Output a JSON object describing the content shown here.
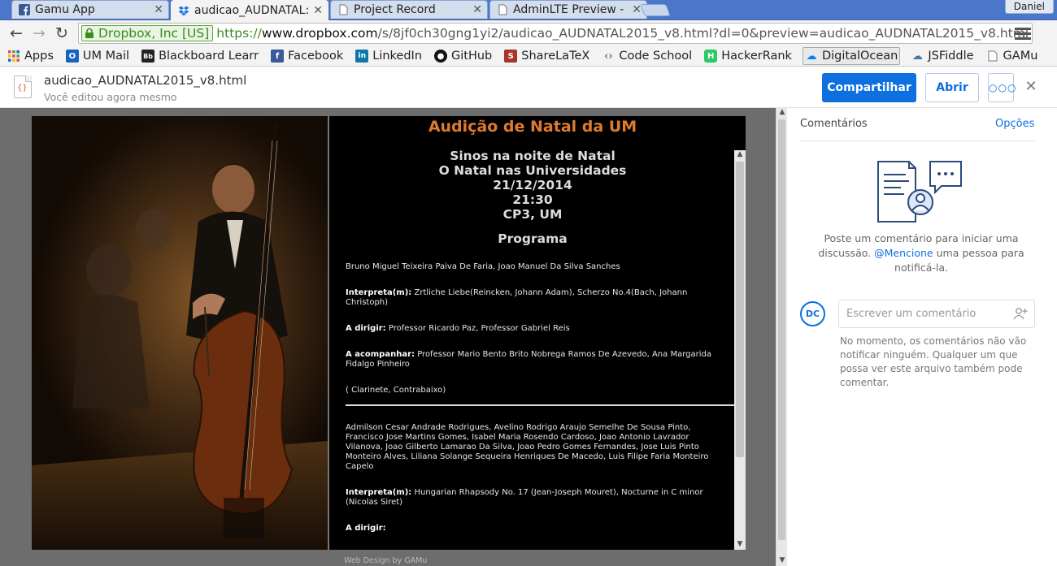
{
  "tabs": [
    {
      "title": "Gamu App",
      "icon": "facebook-icon"
    },
    {
      "title": "audicao_AUDNATAL:",
      "icon": "dropbox-icon"
    },
    {
      "title": "Project Record",
      "icon": "document-icon"
    },
    {
      "title": "AdminLTE Preview - ",
      "icon": "document-icon"
    }
  ],
  "user_badge": "Daniel",
  "address_bar": {
    "ev_label": "Dropbox, Inc [US]",
    "scheme": "https://",
    "host": "www.dropbox.com",
    "path": "/s/8jf0ch30gng1yi2/audicao_AUDNATAL2015_v8.html?dl=0&preview=audicao_AUDNATAL2015_v8.html"
  },
  "bookmarks": [
    {
      "label": "Apps",
      "icon": "apps-grid-icon",
      "color": "#e44"
    },
    {
      "label": "UM Mail",
      "icon": "outlook-icon",
      "color": "#1565c0"
    },
    {
      "label": "Blackboard Learr",
      "icon": "blackboard-icon",
      "color": "#222"
    },
    {
      "label": "Facebook",
      "icon": "facebook-icon",
      "color": "#3b5998"
    },
    {
      "label": "LinkedIn",
      "icon": "linkedin-icon",
      "color": "#0e76a8"
    },
    {
      "label": "GitHub",
      "icon": "github-icon",
      "color": "#111"
    },
    {
      "label": "ShareLaTeX",
      "icon": "sharelatex-icon",
      "color": "#a93529"
    },
    {
      "label": "Code School",
      "icon": "code-icon",
      "color": "#4a7fa0"
    },
    {
      "label": "HackerRank",
      "icon": "hackerrank-icon",
      "color": "#2ec866"
    },
    {
      "label": "DigitalOcean",
      "icon": "cloud-icon",
      "color": "#0080ff"
    },
    {
      "label": "JSFiddle",
      "icon": "cloud-icon",
      "color": "#4679a4"
    },
    {
      "label": "GAMu",
      "icon": "document-icon",
      "color": "#777"
    }
  ],
  "file": {
    "name": "audicao_AUDNATAL2015_v8.html",
    "status": "Você editou agora mesmo",
    "share_label": "Compartilhar",
    "open_label": "Abrir",
    "more_label": "○○○"
  },
  "document": {
    "title": "Audição de Natal da UM",
    "subtitle_lines": [
      "Sinos na noite de Natal",
      "O Natal nas Universidades",
      "21/12/2014",
      "21:30",
      "CP3, UM"
    ],
    "program_heading": "Programa",
    "performers_1": "Bruno Miguel Teixeira Paiva De Faria, Joao Manuel Da Silva Sanches",
    "interpreta_label": "Interpreta(m):",
    "interpreta_1": " Zrtliche Liebe(Reincken, Johann Adam), Scherzo No.4(Bach, Johann Christoph)",
    "dirigir_label": "A dirigir:",
    "dirigir_1": " Professor Ricardo Paz, Professor Gabriel Reis",
    "acompanhar_label": "A acompanhar:",
    "acompanhar_1": " Professor Mario Bento Brito Nobrega Ramos De Azevedo, Ana Margarida Fidalgo Pinheiro",
    "instruments_1": "( Clarinete, Contrabaixo)",
    "performers_2": "Admilson Cesar Andrade Rodrigues, Avelino Rodrigo Araujo Semelhe De Sousa Pinto, Francisco Jose Martins Gomes, Isabel Maria Rosendo Cardoso, Joao Antonio Lavrador Vilanova, Joao Gilberto Lamarao Da Silva, Joao Pedro Gomes Fernandes, Jose Luis Pinto Monteiro Alves, Liliana Solange Sequeira Henriques De Macedo, Luis Filipe Faria Monteiro Capelo",
    "interpreta_2": " Hungarian Rhapsody No. 17 (Jean-Joseph Mouret), Nocturne in C minor (Nicolas Siret)",
    "dirigir_2": ""
  },
  "footer": "Web Design by GAMu",
  "comments": {
    "title": "Comentários",
    "options": "Opções",
    "empty_before": "Poste um comentário para iniciar uma discussão. ",
    "empty_mention": "@Mencione",
    "empty_after": " uma pessoa para notificá-la.",
    "avatar": "DC",
    "input_placeholder": "Escrever um comentário",
    "note": "No momento, os comentários não vão notificar ninguém. Qualquer um que possa ver este arquivo também pode comentar."
  }
}
